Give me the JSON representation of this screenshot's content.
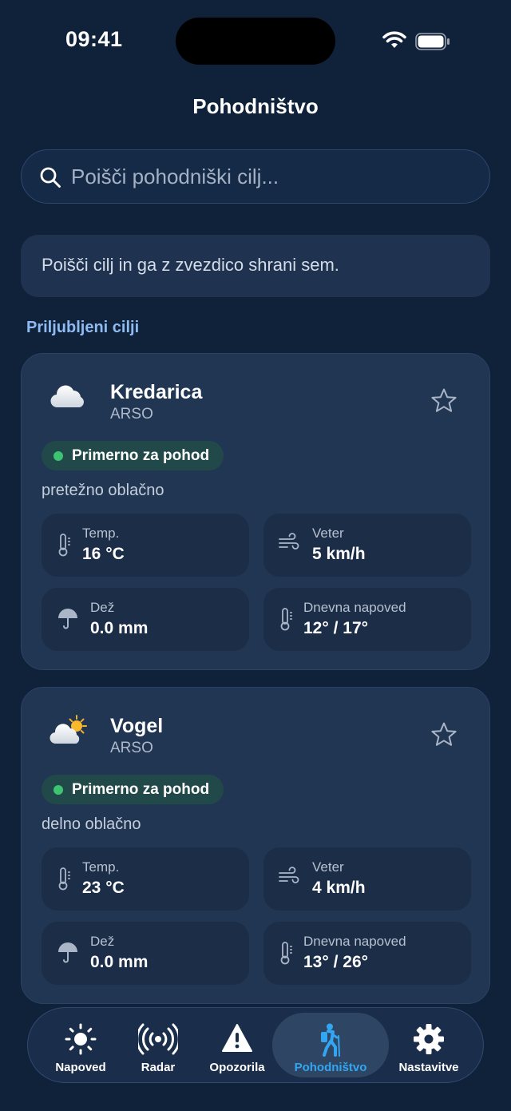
{
  "status_bar": {
    "time": "09:41"
  },
  "header": {
    "title": "Pohodništvo"
  },
  "search": {
    "placeholder": "Poišči pohodniški cilj..."
  },
  "hint": {
    "text": "Poišči cilj in ga z zvezdico shrani sem."
  },
  "favorites": {
    "title": "Priljubljeni cilji",
    "cards": [
      {
        "name": "Kredarica",
        "source": "ARSO",
        "weather_icon": "cloud-icon",
        "badge": "Primerno za pohod",
        "description": "pretežno oblačno",
        "temp_label": "Temp.",
        "temp_value": "16 °C",
        "wind_label": "Veter",
        "wind_value": "5 km/h",
        "rain_label": "Dež",
        "rain_value": "0.0 mm",
        "forecast_label": "Dnevna napoved",
        "forecast_value": "12° / 17°"
      },
      {
        "name": "Vogel",
        "source": "ARSO",
        "weather_icon": "partly-sunny-icon",
        "badge": "Primerno za pohod",
        "description": "delno oblačno",
        "temp_label": "Temp.",
        "temp_value": "23 °C",
        "wind_label": "Veter",
        "wind_value": "4 km/h",
        "rain_label": "Dež",
        "rain_value": "0.0 mm",
        "forecast_label": "Dnevna napoved",
        "forecast_value": "13° / 26°"
      }
    ]
  },
  "tabs": [
    {
      "label": "Napoved",
      "icon": "sun-icon"
    },
    {
      "label": "Radar",
      "icon": "radar-icon"
    },
    {
      "label": "Opozorila",
      "icon": "warning-icon"
    },
    {
      "label": "Pohodništvo",
      "icon": "hiker-icon",
      "active": true
    },
    {
      "label": "Nastavitve",
      "icon": "gear-icon"
    }
  ],
  "colors": {
    "background": "#10213a",
    "card": "#213652",
    "accent": "#32a6f2",
    "badge_dot": "#3cc471",
    "section_title": "#8fbaf2"
  }
}
